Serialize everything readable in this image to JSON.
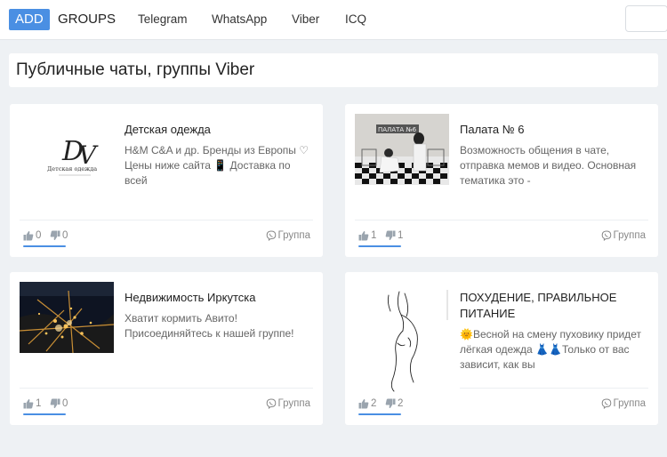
{
  "header": {
    "brand_badge": "ADD",
    "brand_text": "GROUPS",
    "nav": [
      "Telegram",
      "WhatsApp",
      "Viber",
      "ICQ"
    ]
  },
  "page": {
    "title": "Публичные чаты, группы Viber"
  },
  "cards": [
    {
      "title": "Детская одежда",
      "description": "H&M C&A и др. Бренды из Европы ♡ Цены ниже сайта 📱 Доставка по всей",
      "likes": "0",
      "dislikes": "0",
      "type": "Группа",
      "logo_text": "Детская одежда"
    },
    {
      "title": "Палата № 6",
      "description": "Возможность общения в чате, отправка мемов и видео. Основная тематика это -",
      "likes": "1",
      "dislikes": "1",
      "type": "Группа"
    },
    {
      "title": "Недвижимость Иркутска",
      "description": "Хватит кормить Авито! Присоединяйтесь к нашей группе!",
      "likes": "1",
      "dislikes": "0",
      "type": "Группа"
    },
    {
      "title": "ПОХУДЕНИЕ, ПРАВИЛЬНОЕ ПИТАНИЕ",
      "description": "🌞Весной на смену пуховику придет лёгкая одежда 👗👗Только от вас зависит, как вы",
      "likes": "2",
      "dislikes": "2",
      "type": "Группа"
    }
  ]
}
